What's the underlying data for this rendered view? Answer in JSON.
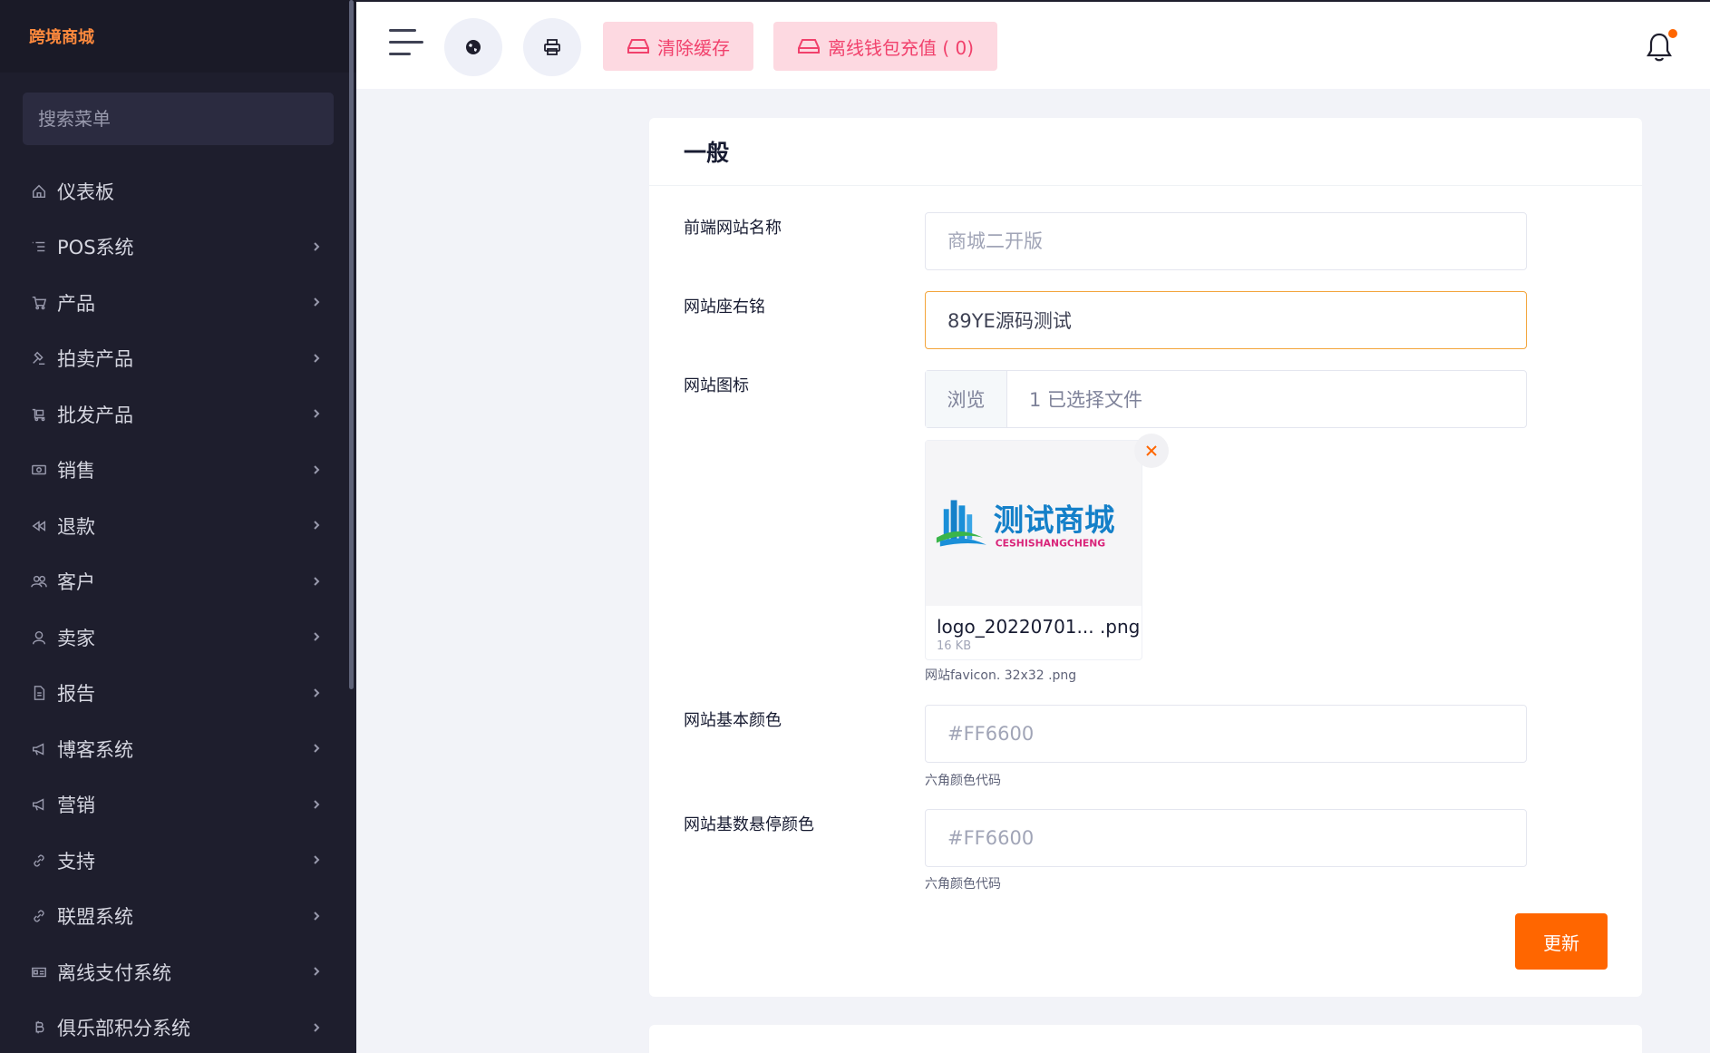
{
  "sidebar": {
    "brand": "跨境商城",
    "search_placeholder": "搜索菜单",
    "items": [
      {
        "label": "仪表板",
        "icon": "home-icon",
        "has_arrow": false
      },
      {
        "label": "POS系统",
        "icon": "list-icon",
        "has_arrow": true
      },
      {
        "label": "产品",
        "icon": "cart-icon",
        "has_arrow": true
      },
      {
        "label": "拍卖产品",
        "icon": "gavel-icon",
        "has_arrow": true
      },
      {
        "label": "批发产品",
        "icon": "wholesale-icon",
        "has_arrow": true
      },
      {
        "label": "销售",
        "icon": "money-icon",
        "has_arrow": true
      },
      {
        "label": "退款",
        "icon": "rewind-icon",
        "has_arrow": true
      },
      {
        "label": "客户",
        "icon": "users-icon",
        "has_arrow": true
      },
      {
        "label": "卖家",
        "icon": "user-icon",
        "has_arrow": true
      },
      {
        "label": "报告",
        "icon": "file-icon",
        "has_arrow": true
      },
      {
        "label": "博客系统",
        "icon": "megaphone-icon",
        "has_arrow": true
      },
      {
        "label": "营销",
        "icon": "megaphone-icon",
        "has_arrow": true
      },
      {
        "label": "支持",
        "icon": "link-icon",
        "has_arrow": true
      },
      {
        "label": "联盟系统",
        "icon": "link-icon",
        "has_arrow": true
      },
      {
        "label": "离线支付系统",
        "icon": "cash-icon",
        "has_arrow": true
      },
      {
        "label": "俱乐部积分系统",
        "icon": "bitcoin-icon",
        "has_arrow": true
      }
    ]
  },
  "header": {
    "clear_cache_label": "清除缓存",
    "offline_wallet_label": "离线钱包充值 ( 0)"
  },
  "card": {
    "title": "一般",
    "fields": {
      "site_name": {
        "label": "前端网站名称",
        "placeholder": "商城二开版",
        "value": ""
      },
      "motto": {
        "label": "网站座右铭",
        "value": "89YE源码测试"
      },
      "icon": {
        "label": "网站图标",
        "browse_label": "浏览",
        "status": "1 已选择文件"
      },
      "base_color": {
        "label": "网站基本颜色",
        "placeholder": "#FF6600",
        "hint": "六角颜色代码"
      },
      "hover_color": {
        "label": "网站基数悬停颜色",
        "placeholder": "#FF6600",
        "hint": "六角颜色代码"
      }
    },
    "preview": {
      "logo_text": "测试商城",
      "logo_subtext": "CESHISHANGCHENG",
      "file_name": "logo_20220701... .png",
      "file_size": "16 KB",
      "hint": "网站favicon. 32x32 .png"
    },
    "update_label": "更新"
  },
  "colors": {
    "accent": "#FF6600",
    "sidebar_bg": "#1E1E2D",
    "danger_light": "#FDD9E1",
    "danger": "#F1416C"
  }
}
